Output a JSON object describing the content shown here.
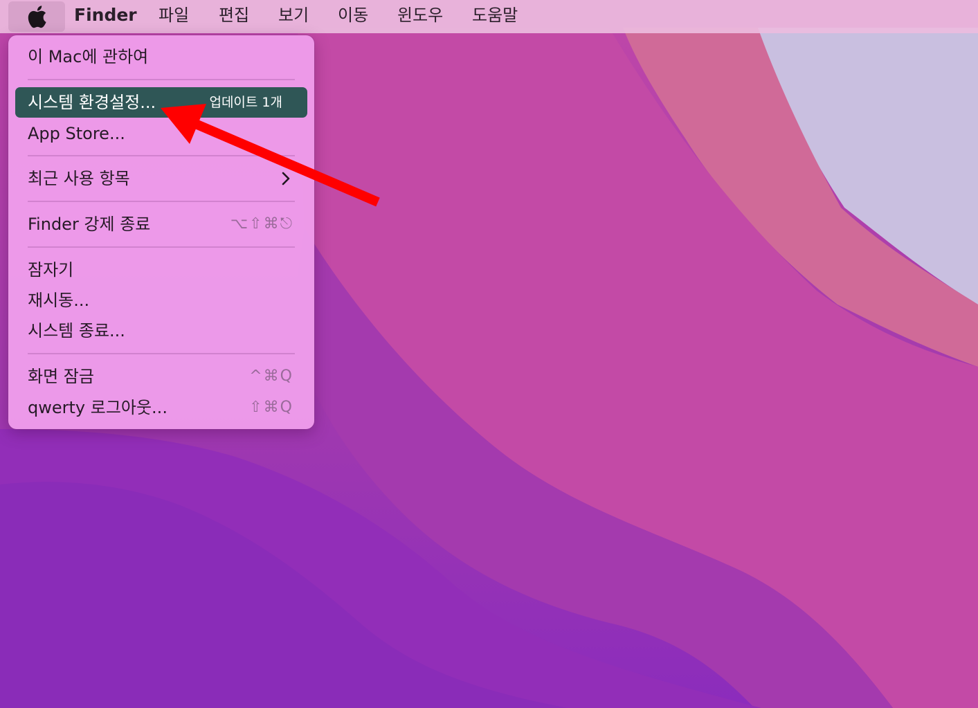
{
  "menubar": {
    "apple_icon": "apple-logo-icon",
    "app_name": "Finder",
    "items": [
      "파일",
      "편집",
      "보기",
      "이동",
      "윈도우",
      "도움말"
    ]
  },
  "apple_menu": {
    "about": "이 Mac에 관하여",
    "system_prefs": {
      "label": "시스템 환경설정...",
      "badge": "업데이트 1개"
    },
    "app_store": "App Store...",
    "recent_items": {
      "label": "최근 사용 항목",
      "icon": "chevron-right-icon"
    },
    "force_quit": {
      "label": "Finder 강제 종료",
      "shortcut": "⌥⇧⌘⎋"
    },
    "sleep": "잠자기",
    "restart": "재시동...",
    "shutdown": "시스템 종료...",
    "lock_screen": {
      "label": "화면 잠금",
      "shortcut": "^⌘Q"
    },
    "logout": {
      "label": "qwerty 로그아웃...",
      "shortcut": "⇧⌘Q"
    }
  },
  "colors": {
    "selection": "#2f5656",
    "annotation_arrow": "#ff0000",
    "wallpaper_top": "#c246a6",
    "wallpaper_bottom": "#8a2ab8"
  }
}
